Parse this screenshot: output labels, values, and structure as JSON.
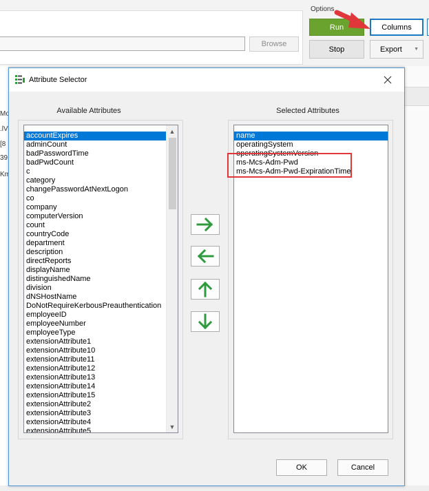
{
  "background": {
    "browse_label": "Browse",
    "options_label": "Options",
    "run_label": "Run",
    "columns_label": "Columns",
    "stop_label": "Stop",
    "export_label": "Export",
    "left_column_fragments": [
      "Mo",
      ".lV",
      "[8",
      "39",
      "Km"
    ]
  },
  "dialog": {
    "title": "Attribute Selector",
    "available_label": "Available Attributes",
    "selected_label": "Selected Attributes",
    "available_attributes": [
      "accountExpires",
      "adminCount",
      "badPasswordTime",
      "badPwdCount",
      "c",
      "category",
      "changePasswordAtNextLogon",
      "co",
      "company",
      "computerVersion",
      "count",
      "countryCode",
      "department",
      "description",
      "directReports",
      "displayName",
      "distinguishedName",
      "division",
      "dNSHostName",
      "DoNotRequireKerbousPreauthentication",
      "employeeID",
      "employeeNumber",
      "employeeType",
      "extensionAttribute1",
      "extensionAttribute10",
      "extensionAttribute11",
      "extensionAttribute12",
      "extensionAttribute13",
      "extensionAttribute14",
      "extensionAttribute15",
      "extensionAttribute2",
      "extensionAttribute3",
      "extensionAttribute4",
      "extensionAttribute5"
    ],
    "available_selected_index": 0,
    "selected_attributes": [
      "name",
      "operatingSystem",
      "operatingSystemVersion",
      "ms-Mcs-Adm-Pwd",
      "ms-Mcs-Adm-Pwd-ExpirationTime"
    ],
    "selected_selected_index": 0,
    "ok_label": "OK",
    "cancel_label": "Cancel"
  },
  "colors": {
    "accent": "#0078d7",
    "run_green": "#6aa42f",
    "move_arrow_green": "#2e9a3e",
    "annotation_red": "#e0383a"
  },
  "icons": {
    "title": "attribute-list-icon",
    "close": "close-icon",
    "move_right": "arrow-right-icon",
    "move_left": "arrow-left-icon",
    "move_up": "arrow-up-icon",
    "move_down": "arrow-down-icon"
  }
}
